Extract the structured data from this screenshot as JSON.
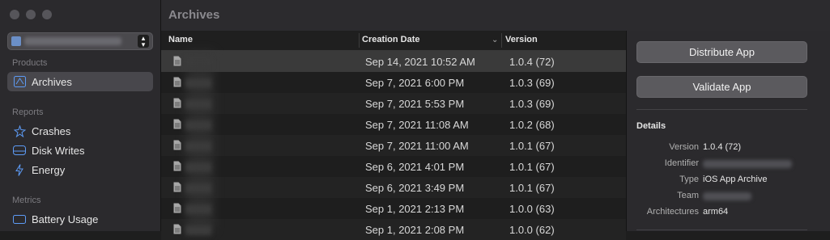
{
  "window": {
    "title": "Archives"
  },
  "sidebar": {
    "sections": [
      {
        "label": "Products",
        "items": [
          {
            "label": "Archives",
            "icon": "archive-icon",
            "selected": true
          }
        ]
      },
      {
        "label": "Reports",
        "items": [
          {
            "label": "Crashes",
            "icon": "crash-burst-icon"
          },
          {
            "label": "Disk Writes",
            "icon": "disk-icon"
          },
          {
            "label": "Energy",
            "icon": "lightning-icon"
          }
        ]
      },
      {
        "label": "Metrics",
        "items": [
          {
            "label": "Battery Usage",
            "icon": "battery-icon"
          }
        ]
      }
    ]
  },
  "table": {
    "columns": {
      "name": "Name",
      "date": "Creation Date",
      "version": "Version"
    },
    "rows": [
      {
        "date": "Sep 14, 2021 10:52 AM",
        "version": "1.0.4 (72)",
        "selected": true
      },
      {
        "date": "Sep 7, 2021 6:00 PM",
        "version": "1.0.3 (69)"
      },
      {
        "date": "Sep 7, 2021 5:53 PM",
        "version": "1.0.3 (69)"
      },
      {
        "date": "Sep 7, 2021 11:08 AM",
        "version": "1.0.2 (68)"
      },
      {
        "date": "Sep 7, 2021 11:00 AM",
        "version": "1.0.1 (67)"
      },
      {
        "date": "Sep 6, 2021 4:01 PM",
        "version": "1.0.1 (67)"
      },
      {
        "date": "Sep 6, 2021 3:49 PM",
        "version": "1.0.1 (67)"
      },
      {
        "date": "Sep 1, 2021 2:13 PM",
        "version": "1.0.0 (63)"
      },
      {
        "date": "Sep 1, 2021 2:08 PM",
        "version": "1.0.0 (62)"
      }
    ]
  },
  "panel": {
    "distribute_label": "Distribute App",
    "validate_label": "Validate App",
    "details_heading": "Details",
    "details": {
      "version_label": "Version",
      "version_value": "1.0.4 (72)",
      "identifier_label": "Identifier",
      "type_label": "Type",
      "type_value": "iOS App Archive",
      "team_label": "Team",
      "arch_label": "Architectures",
      "arch_value": "arm64"
    }
  },
  "colors": {
    "accent": "#5d9bf5",
    "background": "#1e1e1e",
    "sidebar": "#2b2a2d"
  }
}
